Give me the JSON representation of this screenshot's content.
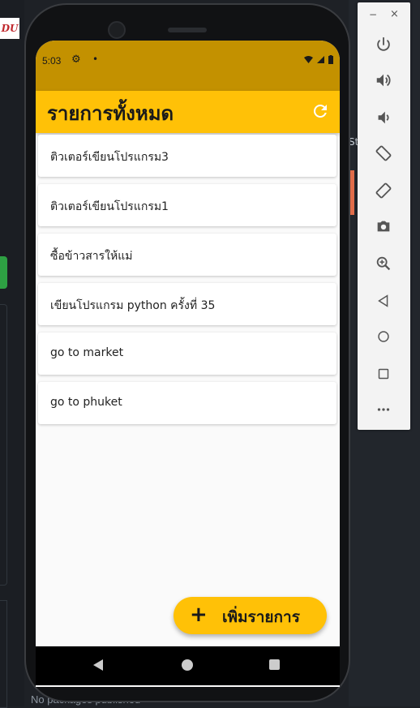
{
  "background": {
    "logo_text": "DU",
    "side_label": "St",
    "bottom_text": "No packages published"
  },
  "status_bar": {
    "time": "5:03",
    "settings_icon": "gear-icon",
    "notification_icon": "dot-icon",
    "system_icons": [
      "wifi-icon",
      "signal-icon",
      "battery-icon"
    ]
  },
  "app_bar": {
    "title": "รายการทั้งหมด",
    "refresh_icon": "refresh-icon",
    "color": "#ffc107",
    "status_color": "#c39100"
  },
  "todos": [
    {
      "text": "ติวเตอร์เขียนโปรแกรม3"
    },
    {
      "text": "ติวเตอร์เขียนโปรแกรม1"
    },
    {
      "text": "ซื้อข้าวสารให้แม่"
    },
    {
      "text": "เขียนโปรแกรม python ครั้งที่ 35"
    },
    {
      "text": "go to market"
    },
    {
      "text": "go to phuket"
    }
  ],
  "fab": {
    "icon": "plus-icon",
    "label": "เพิ่มรายการ"
  },
  "nav": {
    "back_icon": "back-triangle-icon",
    "home_icon": "home-circle-icon",
    "recent_icon": "recent-square-icon"
  },
  "emulator_toolbar": {
    "minimize": "−",
    "close": "×",
    "buttons": [
      "power-icon",
      "volume-up-icon",
      "volume-down-icon",
      "rotate-left-icon",
      "rotate-right-icon",
      "camera-icon",
      "zoom-icon",
      "back-icon",
      "home-icon",
      "overview-icon",
      "more-icon"
    ]
  }
}
